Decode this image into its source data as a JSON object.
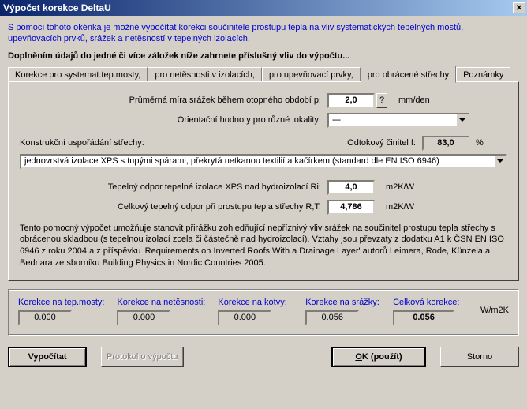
{
  "title": "Výpočet korekce DeltaU",
  "intro": "S pomocí tohoto okénka je možné vypočítat korekci součinitele prostupu tepla na vliv systematických tepelných mostů, upevňovacích prvků, srážek a netěsností v tepelných izolacích.",
  "subhead": "Doplněním údajů do jedné či více záložek níže zahrnete příslušný vliv do výpočtu...",
  "tabs": {
    "t0": "Korekce pro systemat.tep.mosty,",
    "t1": "pro netěsnosti v izolacích,",
    "t2": "pro upevňovací prvky,",
    "t3": "pro obrácené střechy",
    "t4": "Poznámky"
  },
  "panel": {
    "p_label": "Průměrná míra srážek během otopného období p:",
    "p_value": "2,0",
    "p_unit": "mm/den",
    "locality_label": "Orientační hodnoty pro různé lokality:",
    "locality_value": "---",
    "construction_label": "Konstrukční uspořádání střechy:",
    "f_label": "Odtokový činitel f:",
    "f_value": "83,0",
    "f_unit": "%",
    "construction_value": "jednovrstvá izolace XPS s tupými spárami, překrytá netkanou textilií a kačírkem (standard dle EN ISO 6946)",
    "ri_label": "Tepelný odpor tepelné izolace XPS nad hydroizolací Ri:",
    "ri_value": "4,0",
    "ri_unit": "m2K/W",
    "rt_label": "Celkový tepelný odpor při prostupu tepla střechy R,T:",
    "rt_value": "4,786",
    "rt_unit": "m2K/W",
    "desc": "Tento pomocný výpočet umožňuje stanovit přirážku zohledňující nepříznivý vliv srážek na součinitel prostupu tepla střechy s obrácenou skladbou (s tepelnou izolací zcela či částečně nad hydroizolací). Vztahy jsou převzaty z dodatku A1 k ČSN EN ISO 6946 z roku 2004 a z příspěvku 'Requirements on Inverted Roofs With a Drainage Layer' autorů Leimera, Rode, Künzela a Bednara ze sborníku Building Physics in Nordic Countries 2005."
  },
  "results": {
    "c0_label": "Korekce na tep.mosty:",
    "c0_value": "0.000",
    "c1_label": "Korekce na netěsnosti:",
    "c1_value": "0.000",
    "c2_label": "Korekce na kotvy:",
    "c2_value": "0.000",
    "c3_label": "Korekce na srážky:",
    "c3_value": "0.056",
    "total_label": "Celková korekce:",
    "total_value": "0.056",
    "unit": "W/m2K"
  },
  "buttons": {
    "calc": "Vypočítat",
    "protocol": "Protokol o výpočtu",
    "ok": "OK (použít)",
    "cancel": "Storno"
  },
  "icons": {
    "q": "?"
  }
}
